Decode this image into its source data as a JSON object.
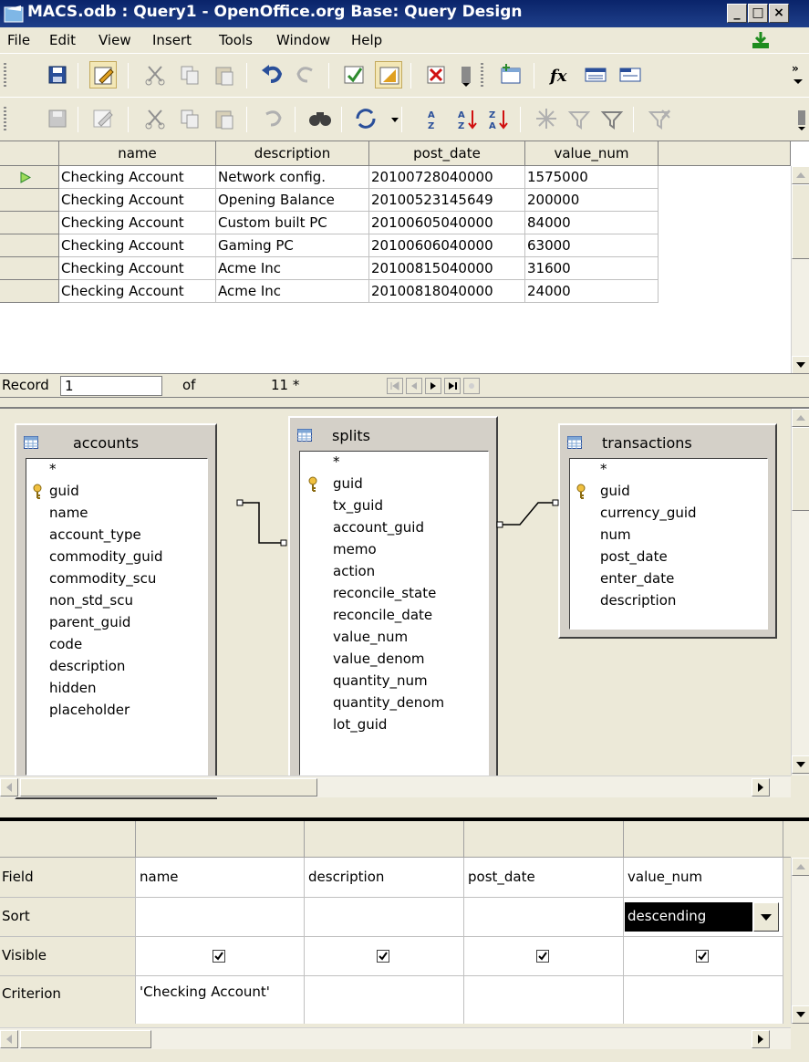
{
  "window": {
    "title": "MACS.odb : Query1 - OpenOffice.org Base: Query Design",
    "minimize": "_",
    "maximize": "□",
    "close": "×"
  },
  "menu": [
    "File",
    "Edit",
    "View",
    "Insert",
    "Tools",
    "Window",
    "Help"
  ],
  "grid": {
    "columns": [
      "name",
      "description",
      "post_date",
      "value_num"
    ],
    "rows": [
      [
        "Checking Account",
        "Network config.",
        "20100728040000",
        "1575000"
      ],
      [
        "Checking Account",
        "Opening Balance",
        "20100523145649",
        "200000"
      ],
      [
        "Checking Account",
        "Custom built PC",
        "20100605040000",
        "84000"
      ],
      [
        "Checking Account",
        "Gaming PC",
        "20100606040000",
        "63000"
      ],
      [
        "Checking Account",
        "Acme Inc",
        "20100815040000",
        "31600"
      ],
      [
        "Checking Account",
        "Acme Inc",
        "20100818040000",
        "24000"
      ]
    ]
  },
  "recordbar": {
    "label": "Record",
    "value": "1",
    "of": "of",
    "count": "11 *"
  },
  "tables": {
    "accounts": {
      "name": "accounts",
      "fields": [
        "*",
        "guid",
        "name",
        "account_type",
        "commodity_guid",
        "commodity_scu",
        "non_std_scu",
        "parent_guid",
        "code",
        "description",
        "hidden",
        "placeholder"
      ]
    },
    "splits": {
      "name": "splits",
      "fields": [
        "*",
        "guid",
        "tx_guid",
        "account_guid",
        "memo",
        "action",
        "reconcile_state",
        "reconcile_date",
        "value_num",
        "value_denom",
        "quantity_num",
        "quantity_denom",
        "lot_guid"
      ]
    },
    "transactions": {
      "name": "transactions",
      "fields": [
        "*",
        "guid",
        "currency_guid",
        "num",
        "post_date",
        "enter_date",
        "description"
      ]
    }
  },
  "design": {
    "row_labels": {
      "field": "Field",
      "sort": "Sort",
      "visible": "Visible",
      "criterion": "Criterion"
    },
    "columns": [
      {
        "field": "name",
        "sort": "",
        "visible": true,
        "criterion": "'Checking Account'"
      },
      {
        "field": "description",
        "sort": "",
        "visible": true,
        "criterion": ""
      },
      {
        "field": "post_date",
        "sort": "",
        "visible": true,
        "criterion": ""
      },
      {
        "field": "value_num",
        "sort": "descending",
        "visible": true,
        "criterion": ""
      }
    ]
  },
  "colors": {
    "titlebar": "#0a246a",
    "selected_sort_bg": "#000000",
    "key_icon": "#d4a017",
    "row_marker": "#2e8b2e"
  }
}
